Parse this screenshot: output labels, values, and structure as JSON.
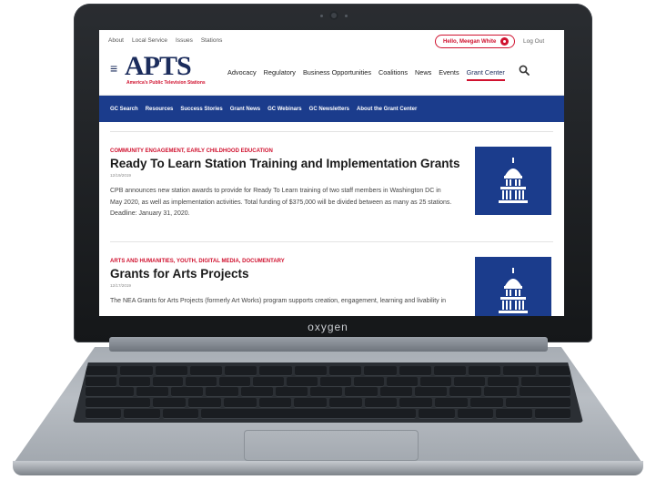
{
  "laptop": {
    "brand": "oxygen"
  },
  "header": {
    "util_links": [
      "About",
      "Local Service",
      "Issues",
      "Stations"
    ],
    "greeting": "Hello, Meegan White",
    "logout": "Log Out",
    "logo": {
      "wordmark": "APTS",
      "tagline": "America's Public Television Stations"
    },
    "nav": [
      "Advocacy",
      "Regulatory",
      "Business Opportunities",
      "Coalitions",
      "News",
      "Events",
      "Grant Center"
    ],
    "active_nav": "Grant Center"
  },
  "gc_nav": [
    "GC Search",
    "Resources",
    "Success Stories",
    "Grant News",
    "GC Webinars",
    "GC Newsletters",
    "About the Grant Center"
  ],
  "articles": [
    {
      "tags": "COMMUNITY ENGAGEMENT, EARLY CHILDHOOD EDUCATION",
      "title": "Ready To Learn Station Training and Implementation Grants",
      "date": "12/19/2019",
      "summary": "CPB announces new station awards to provide for Ready To Learn training of two staff members in Washington DC in May 2020, as well as implementation activities. Total funding of $375,000 will be divided between as many as 25 stations. Deadline: January 31, 2020.",
      "thumb_icon": "capitol-building-icon"
    },
    {
      "tags": "ARTS AND HUMANITIES, YOUTH, DIGITAL MEDIA, DOCUMENTARY",
      "title": "Grants for Arts Projects",
      "date": "12/17/2019",
      "summary": "The NEA Grants for Arts Projects (formerly Art Works) program supports creation, engagement, learning and livability in",
      "thumb_icon": "capitol-building-icon"
    }
  ],
  "colors": {
    "brand_navy": "#1b2c5c",
    "gc_bar": "#1b3c8c",
    "accent_red": "#d0122f"
  }
}
